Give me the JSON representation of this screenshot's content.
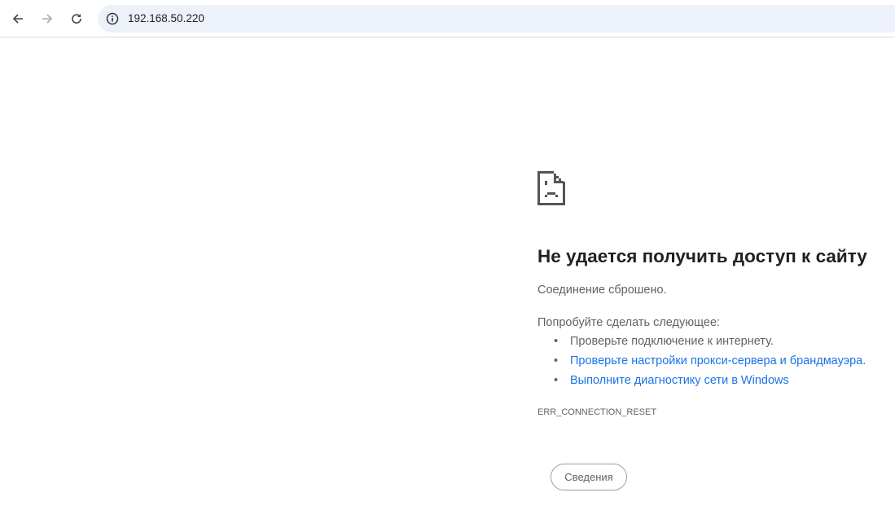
{
  "browser": {
    "url": "192.168.50.220"
  },
  "error": {
    "title": "Не удается получить доступ к сайту",
    "subtitle": "Соединение сброшено.",
    "suggest_heading": "Попробуйте сделать следующее:",
    "suggestions": [
      {
        "label": "Проверьте подключение к интернету.",
        "link": false
      },
      {
        "label": "Проверьте настройки прокси-сервера и брандмауэра.",
        "link": true
      },
      {
        "label": "Выполните диагностику сети в Windows",
        "link": true
      }
    ],
    "code": "ERR_CONNECTION_RESET",
    "details_button": "Сведения"
  }
}
